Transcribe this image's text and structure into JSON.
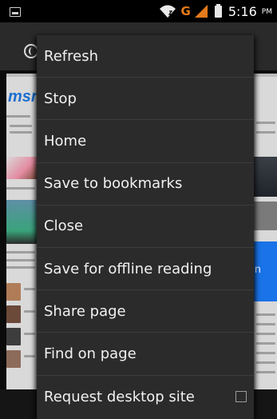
{
  "status_bar": {
    "network_type": "G",
    "time": "5:16",
    "ampm": "PM"
  },
  "menu": {
    "items": [
      {
        "label": "Refresh"
      },
      {
        "label": "Stop"
      },
      {
        "label": "Home"
      },
      {
        "label": "Save to bookmarks"
      },
      {
        "label": "Close"
      },
      {
        "label": "Save for offline reading"
      },
      {
        "label": "Share page"
      },
      {
        "label": "Find on page"
      },
      {
        "label": "Request desktop site",
        "checkbox": true,
        "checked": false
      }
    ]
  },
  "webpage": {
    "logo_text": "msn",
    "blue_box_text": "n"
  },
  "colors": {
    "menu_background": "#2b2b2b",
    "menu_text": "#f1f1f1",
    "menu_divider": "#3c3c3c",
    "network_accent": "#e57b1a",
    "status_bar": "#000000"
  }
}
